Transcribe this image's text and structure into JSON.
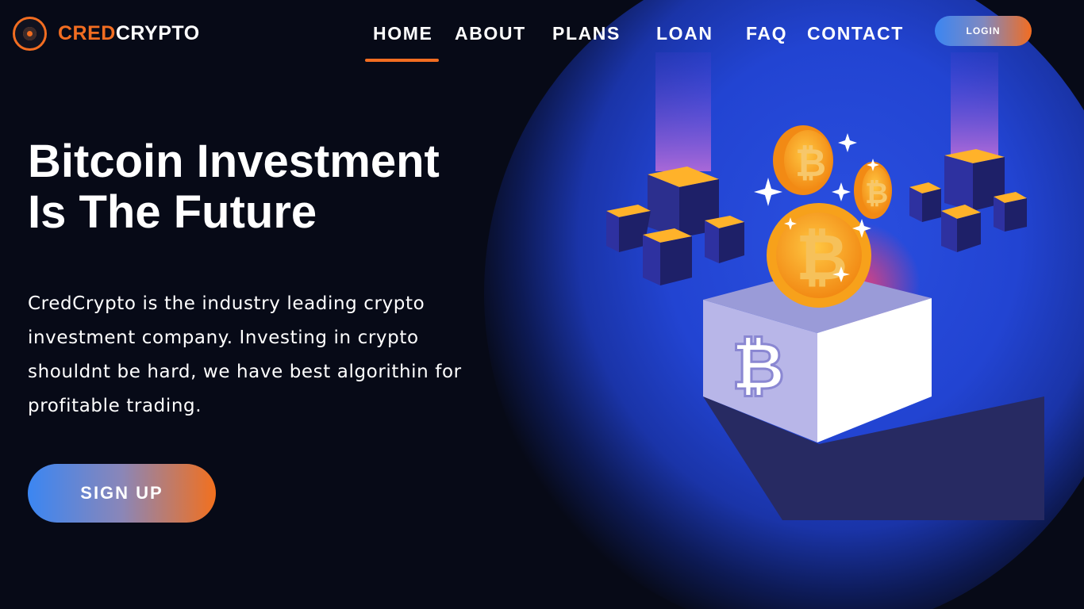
{
  "brand": {
    "name_part1": "CRED",
    "name_part2": "CRYPTO",
    "accent": "#f26d21",
    "logo_icon": "logo-mark-icon"
  },
  "nav": {
    "items": [
      {
        "label": "HOME",
        "active": true
      },
      {
        "label": "ABOUT"
      },
      {
        "label": "PLANS"
      },
      {
        "label": "LOAN"
      },
      {
        "label": "FAQ"
      },
      {
        "label": "CONTACT"
      }
    ],
    "login_label": "LOGIN"
  },
  "hero": {
    "title_line1": "Bitcoin Investment",
    "title_line2": "Is The Future",
    "description": "CredCrypto is the industry leading crypto investment company. Investing in crypto shouldnt be hard, we have best algorithin for profitable trading.",
    "cta_label": "SIGN UP"
  },
  "illustration": {
    "icon": "bitcoin-investment-illustration",
    "symbol": "₿"
  },
  "colors": {
    "background": "#070a17",
    "glow": "#2244d2",
    "coin": "#f7a31c",
    "gradient_start": "#3b86f2",
    "gradient_end": "#f26d21"
  }
}
